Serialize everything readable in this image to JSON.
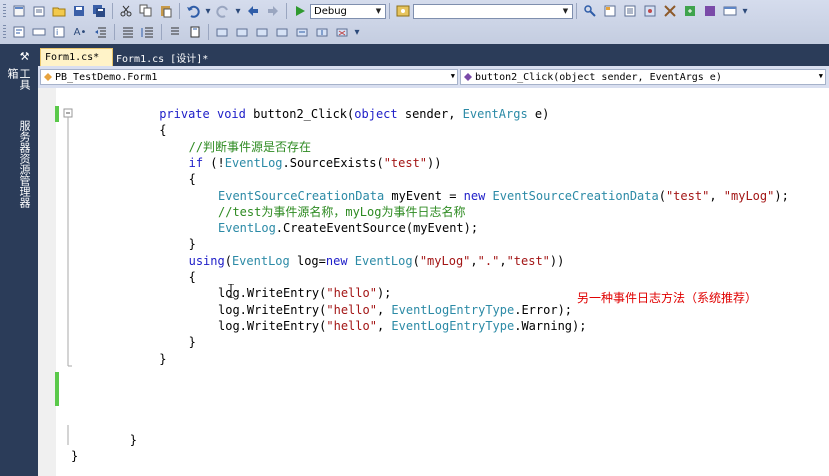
{
  "toolbar": {
    "config_combo": "Debug",
    "search_combo": ""
  },
  "side_tabs": {
    "toolbox": "工具箱",
    "server_explorer": "服务器资源管理器"
  },
  "doc_tabs": [
    {
      "label": "Form1.cs*",
      "active": true
    },
    {
      "label": "Form1.cs [设计]*",
      "active": false
    }
  ],
  "nav": {
    "class_combo": "PB_TestDemo.Form1",
    "member_combo": "button2_Click(object sender, EventArgs e)"
  },
  "code_lines": [
    {
      "indent": 6,
      "tokens": [
        {
          "t": "private ",
          "c": "kw"
        },
        {
          "t": "void ",
          "c": "kw"
        },
        {
          "t": "button2_Click(",
          "c": ""
        },
        {
          "t": "object ",
          "c": "kw"
        },
        {
          "t": "sender, ",
          "c": ""
        },
        {
          "t": "EventArgs ",
          "c": "tp"
        },
        {
          "t": "e)",
          "c": ""
        }
      ]
    },
    {
      "indent": 6,
      "tokens": [
        {
          "t": "{",
          "c": ""
        }
      ]
    },
    {
      "indent": 8,
      "tokens": [
        {
          "t": "//判断事件源是否存在",
          "c": "cm"
        }
      ]
    },
    {
      "indent": 8,
      "tokens": [
        {
          "t": "if ",
          "c": "kw"
        },
        {
          "t": "(!",
          "c": ""
        },
        {
          "t": "EventLog",
          "c": "tp"
        },
        {
          "t": ".SourceExists(",
          "c": ""
        },
        {
          "t": "\"test\"",
          "c": "st"
        },
        {
          "t": "))",
          "c": ""
        }
      ]
    },
    {
      "indent": 8,
      "tokens": [
        {
          "t": "{",
          "c": ""
        }
      ]
    },
    {
      "indent": 10,
      "tokens": [
        {
          "t": "EventSourceCreationData ",
          "c": "tp"
        },
        {
          "t": "myEvent = ",
          "c": ""
        },
        {
          "t": "new ",
          "c": "kw"
        },
        {
          "t": "EventSourceCreationData",
          "c": "tp"
        },
        {
          "t": "(",
          "c": ""
        },
        {
          "t": "\"test\"",
          "c": "st"
        },
        {
          "t": ", ",
          "c": ""
        },
        {
          "t": "\"myLog\"",
          "c": "st"
        },
        {
          "t": ");",
          "c": ""
        }
      ]
    },
    {
      "indent": 10,
      "tokens": [
        {
          "t": "//test为事件源名称，myLog为事件日志名称",
          "c": "cm"
        }
      ]
    },
    {
      "indent": 10,
      "tokens": [
        {
          "t": "EventLog",
          "c": "tp"
        },
        {
          "t": ".CreateEventSource(myEvent);",
          "c": ""
        }
      ]
    },
    {
      "indent": 8,
      "tokens": [
        {
          "t": "}",
          "c": ""
        }
      ]
    },
    {
      "indent": 8,
      "tokens": [
        {
          "t": "using",
          "c": "kw"
        },
        {
          "t": "(",
          "c": ""
        },
        {
          "t": "EventLog ",
          "c": "tp"
        },
        {
          "t": "log=",
          "c": ""
        },
        {
          "t": "new ",
          "c": "kw"
        },
        {
          "t": "EventLog",
          "c": "tp"
        },
        {
          "t": "(",
          "c": ""
        },
        {
          "t": "\"myLog\"",
          "c": "st"
        },
        {
          "t": ",",
          "c": ""
        },
        {
          "t": "\".\"",
          "c": "st"
        },
        {
          "t": ",",
          "c": ""
        },
        {
          "t": "\"test\"",
          "c": "st"
        },
        {
          "t": "))",
          "c": ""
        }
      ]
    },
    {
      "indent": 8,
      "tokens": [
        {
          "t": "{",
          "c": ""
        }
      ]
    },
    {
      "indent": 10,
      "tokens": [
        {
          "t": "log.WriteEntry(",
          "c": ""
        },
        {
          "t": "\"hello\"",
          "c": "st"
        },
        {
          "t": ");",
          "c": ""
        }
      ]
    },
    {
      "indent": 10,
      "tokens": [
        {
          "t": "log.WriteEntry(",
          "c": ""
        },
        {
          "t": "\"hello\"",
          "c": "st"
        },
        {
          "t": ", ",
          "c": ""
        },
        {
          "t": "EventLogEntryType",
          "c": "tp"
        },
        {
          "t": ".Error);",
          "c": ""
        }
      ]
    },
    {
      "indent": 10,
      "tokens": [
        {
          "t": "log.WriteEntry(",
          "c": ""
        },
        {
          "t": "\"hello\"",
          "c": "st"
        },
        {
          "t": ", ",
          "c": ""
        },
        {
          "t": "EventLogEntryType",
          "c": "tp"
        },
        {
          "t": ".Warning);",
          "c": ""
        }
      ]
    },
    {
      "indent": 8,
      "tokens": [
        {
          "t": "}",
          "c": ""
        }
      ]
    },
    {
      "indent": 6,
      "tokens": [
        {
          "t": "}",
          "c": ""
        }
      ]
    },
    {
      "indent": 0,
      "tokens": []
    },
    {
      "indent": 0,
      "tokens": []
    },
    {
      "indent": 0,
      "tokens": []
    },
    {
      "indent": 0,
      "tokens": []
    },
    {
      "indent": 4,
      "tokens": [
        {
          "t": "}",
          "c": ""
        }
      ]
    },
    {
      "indent": 0,
      "tokens": [
        {
          "t": "}",
          "c": ""
        }
      ]
    }
  ],
  "annotation": "另一种事件日志方法（系统推荐）",
  "colors": {
    "keyword": "#1d1dc8",
    "type": "#2b8aa6",
    "string": "#a31515",
    "comment": "#2e8b22",
    "annotation": "#e00000",
    "change_bar": "#5ac94a"
  }
}
